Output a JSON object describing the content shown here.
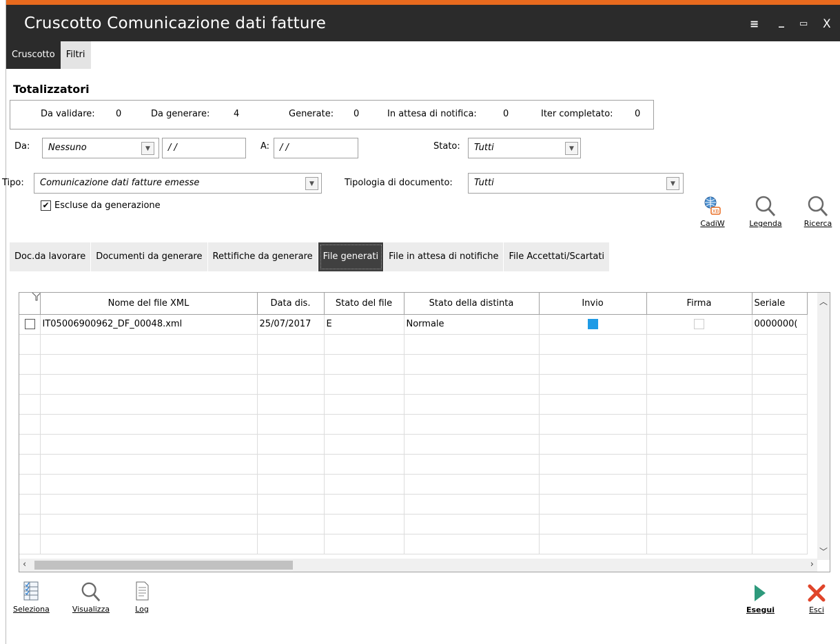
{
  "window": {
    "title": "Cruscotto Comunicazione dati fatture",
    "controls": [
      "≡",
      "_",
      "▭",
      "X"
    ]
  },
  "menu_tabs": [
    {
      "label": "Cruscotto",
      "active": true
    },
    {
      "label": "Filtri",
      "active": false
    }
  ],
  "totalizzatori": {
    "title": "Totalizzatori",
    "items": [
      {
        "label": "Da validare:",
        "value": "0"
      },
      {
        "label": "Da generare:",
        "value": "4"
      },
      {
        "label": "Generate:",
        "value": "0"
      },
      {
        "label": "In attesa di notifica:",
        "value": "0"
      },
      {
        "label": "Iter completato:",
        "value": "0"
      }
    ]
  },
  "filters": {
    "da_label": "Da:",
    "da_value": "Nessuno",
    "da_date": "/ /",
    "a_label": "A:",
    "a_date": "/ /",
    "stato_label": "Stato:",
    "stato_value": "Tutti",
    "tipo_label": "Tipo:",
    "tipo_value": "Comunicazione dati fatture emesse",
    "tipologia_label": "Tipologia di documento:",
    "tipologia_value": "Tutti",
    "escluse_label": "Escluse da generazione",
    "escluse_checked": "✔"
  },
  "tools": {
    "cadiw": "CadiW",
    "legenda": "Legenda",
    "ricerca": "Ricerca"
  },
  "tabs": [
    {
      "label": "Doc.da lavorare",
      "active": false
    },
    {
      "label": "Documenti da generare",
      "active": false
    },
    {
      "label": "Rettifiche da generare",
      "active": false
    },
    {
      "label": "File generati",
      "active": true
    },
    {
      "label": "File in attesa di notifiche",
      "active": false
    },
    {
      "label": "File Accettati/Scartati",
      "active": false
    }
  ],
  "grid": {
    "columns": [
      "",
      "Nome del file XML",
      "Data dis.",
      "Stato del file",
      "Stato della distinta",
      "Invio",
      "Firma",
      "Seriale"
    ],
    "rows": [
      {
        "file": "IT05006900962_DF_00048.xml",
        "data": "25/07/2017",
        "stato_file": "E",
        "stato_distinta": "Normale",
        "seriale": "0000000("
      }
    ]
  },
  "bottom": {
    "seleziona": "Seleziona",
    "visualizza": "Visualizza",
    "log": "Log",
    "esegui": "Esegui",
    "esci": "Esci"
  },
  "colors": {
    "accent": "#e86a1e",
    "titlebar": "#2b2b2b",
    "invio_blue": "#1e9be6",
    "esegui_green": "#2e9a7c",
    "esci_red": "#e0452a"
  }
}
